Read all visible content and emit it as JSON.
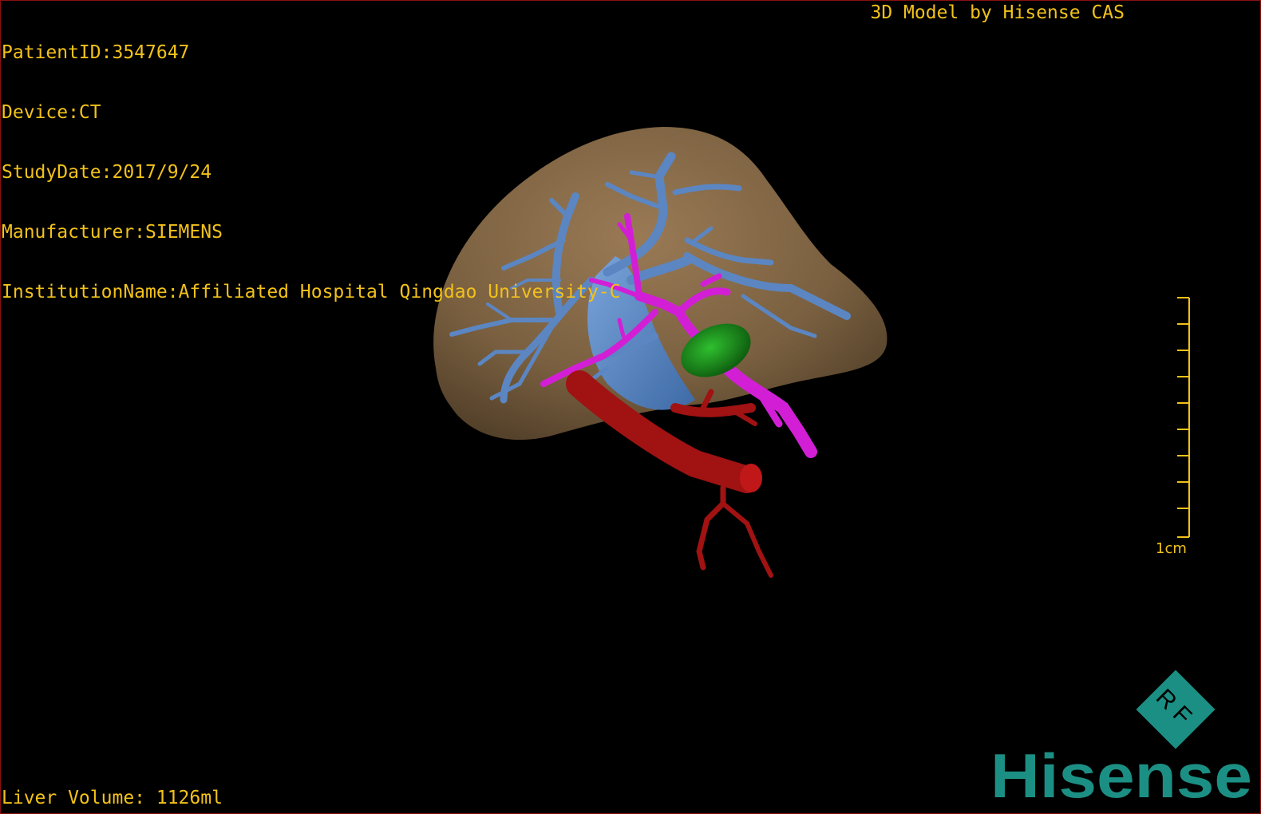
{
  "overlay": {
    "patient_id": "PatientID:3547647",
    "device": "Device:CT",
    "study_date": "StudyDate:2017/9/24",
    "manufacturer": "Manufacturer:SIEMENS",
    "institution": "InstitutionName:Affiliated Hospital Qingdao University-C",
    "model_credit": "3D Model by Hisense CAS",
    "liver_volume": "Liver Volume: 1126ml"
  },
  "scale_bar": {
    "label": "1cm"
  },
  "logo": {
    "badge_text": "RF",
    "brand_text": "Hisense"
  },
  "colors": {
    "overlay_text": "#f2c21a",
    "liver": "#7a6040",
    "hepatic_vein": "#5b86c2",
    "portal_vein": "#d21fd6",
    "artery": "#a11212",
    "gallbladder": "#1e9a1e",
    "logo": "#1c8f84",
    "frame": "#8a1010"
  },
  "icons": [
    "liver-model",
    "hepatic-vein-tree",
    "portal-vein-tree",
    "artery-tree",
    "gallbladder",
    "rf-badge-icon",
    "hisense-logo"
  ]
}
